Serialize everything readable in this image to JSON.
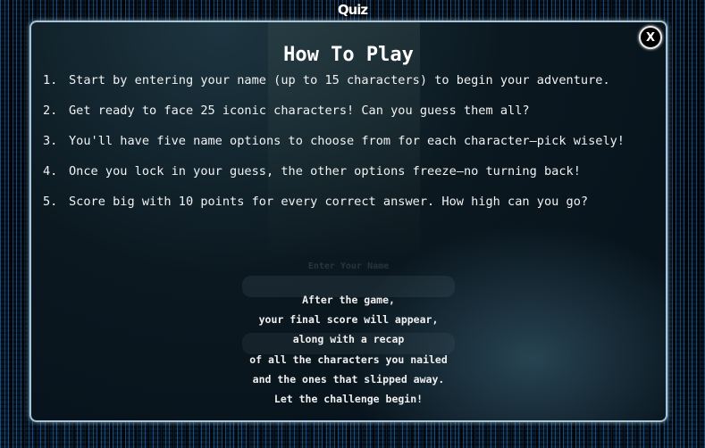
{
  "app": {
    "title": "Quiz"
  },
  "modal": {
    "close_label": "X",
    "title": "How To Play",
    "steps": [
      {
        "number": "1.",
        "text": "Start by entering your name (up to 15 characters) to begin your adventure."
      },
      {
        "number": "2.",
        "text": "Get ready to face 25 iconic characters! Can you guess them all?"
      },
      {
        "number": "3.",
        "text": "You'll have five name options to choose from for each character—pick wisely!"
      },
      {
        "number": "4.",
        "text": "Once you lock in your guess, the other options freeze—no turning back!"
      },
      {
        "number": "5.",
        "text": "Score big with 10 points for every correct answer. How high can you go?"
      }
    ],
    "background_label": "Enter Your Name",
    "recap_lines": [
      "After the game,",
      "your final score will appear,",
      "along with a recap",
      "of all the characters you nailed",
      "and the ones that slipped away.",
      "Let the challenge begin!"
    ]
  },
  "colors": {
    "background": "#02060c",
    "modal_border": "#a9c4d4",
    "text": "#ffffff",
    "matrix_blue": "#2878c8"
  },
  "icons": {
    "close": "close-icon"
  }
}
